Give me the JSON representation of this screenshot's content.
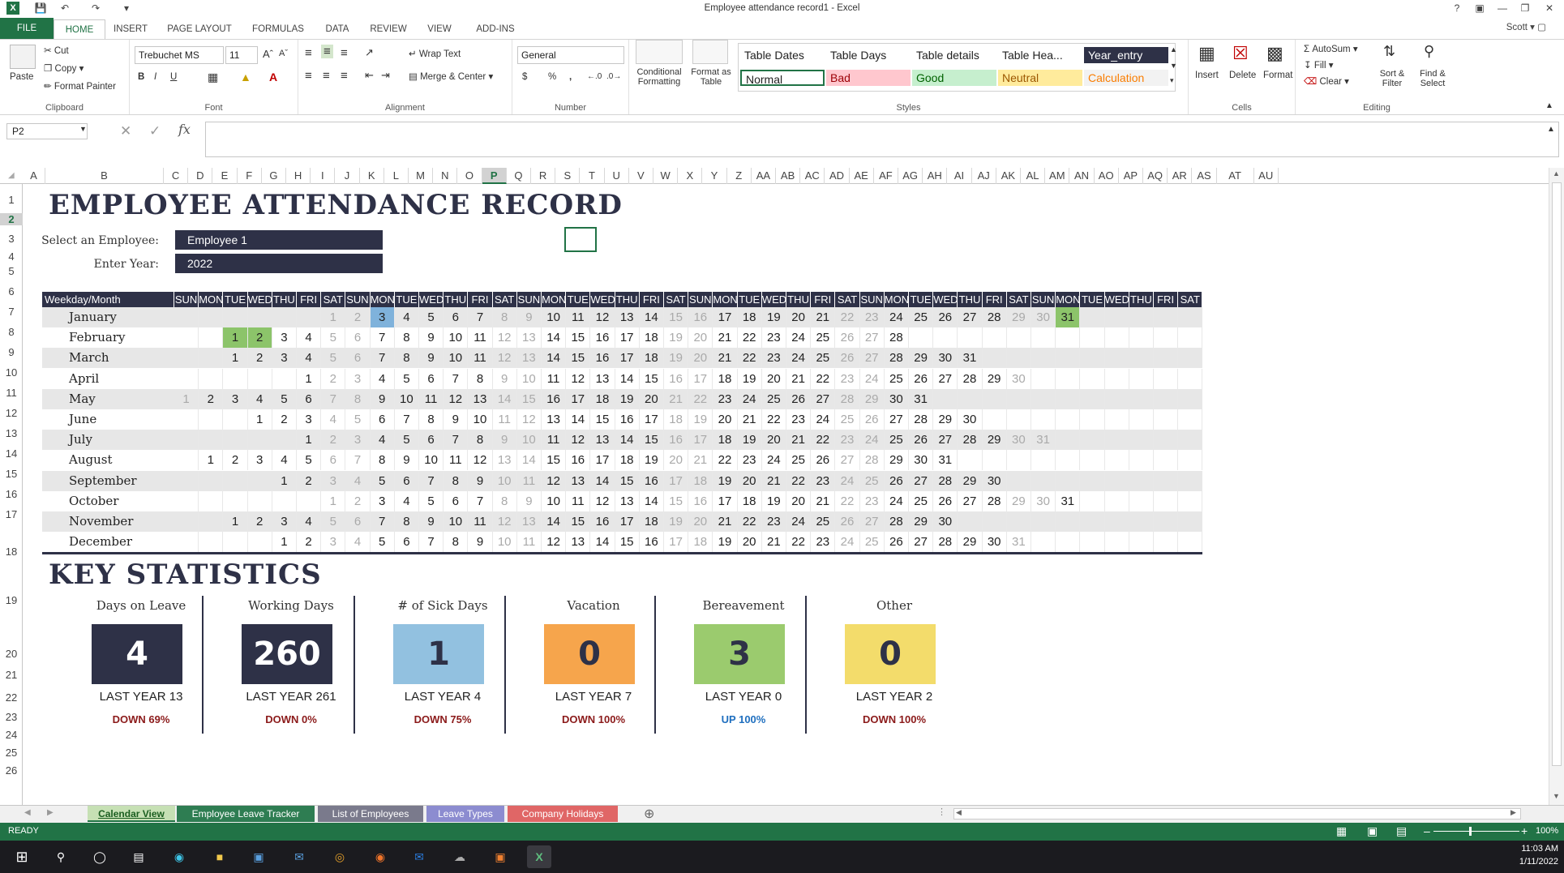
{
  "window": {
    "title": "Employee attendance record1 - Excel",
    "help": "?",
    "user": "Scott"
  },
  "ribbon_tabs": [
    "FILE",
    "HOME",
    "INSERT",
    "PAGE LAYOUT",
    "FORMULAS",
    "DATA",
    "REVIEW",
    "VIEW",
    "ADD-INS"
  ],
  "ribbon": {
    "clipboard": {
      "label": "Clipboard",
      "paste": "Paste",
      "cut": "Cut",
      "copy": "Copy",
      "format_painter": "Format Painter"
    },
    "font": {
      "label": "Font",
      "name": "Trebuchet MS",
      "size": "11",
      "bold": "B",
      "italic": "I",
      "underline": "U"
    },
    "alignment": {
      "label": "Alignment",
      "wrap": "Wrap Text",
      "merge": "Merge & Center"
    },
    "number": {
      "label": "Number",
      "format": "General",
      "currency": "$",
      "percent": "%",
      "comma": ","
    },
    "styles": {
      "label": "Styles",
      "conditional": "Conditional Formatting",
      "format_table": "Format as Table",
      "cells": [
        {
          "text": "Table Dates",
          "bg": "#ffffff",
          "fg": "#222222"
        },
        {
          "text": "Table Days",
          "bg": "#ffffff",
          "fg": "#222222"
        },
        {
          "text": "Table details",
          "bg": "#ffffff",
          "fg": "#222222"
        },
        {
          "text": "Table Hea...",
          "bg": "#ffffff",
          "fg": "#222222"
        },
        {
          "text": "Year_entry",
          "bg": "#2e3147",
          "fg": "#ffffff"
        },
        {
          "text": "Normal",
          "bg": "#ffffff",
          "fg": "#222222"
        },
        {
          "text": "Bad",
          "bg": "#ffc7ce",
          "fg": "#9c0006"
        },
        {
          "text": "Good",
          "bg": "#c6efce",
          "fg": "#006100"
        },
        {
          "text": "Neutral",
          "bg": "#ffeb9c",
          "fg": "#9c5700"
        },
        {
          "text": "Calculation",
          "bg": "#f2f2f2",
          "fg": "#fa7d00"
        }
      ]
    },
    "cells": {
      "label": "Cells",
      "insert": "Insert",
      "delete": "Delete",
      "format": "Format"
    },
    "editing": {
      "label": "Editing",
      "autosum": "AutoSum",
      "fill": "Fill",
      "clear": "Clear",
      "sort": "Sort & Filter",
      "find": "Find & Select"
    }
  },
  "formula_bar": {
    "name_box": "P2",
    "fx": "fx",
    "value": ""
  },
  "columns": [
    "A",
    "B",
    "C",
    "D",
    "E",
    "F",
    "G",
    "H",
    "I",
    "J",
    "K",
    "L",
    "M",
    "N",
    "O",
    "P",
    "Q",
    "R",
    "S",
    "T",
    "U",
    "V",
    "W",
    "X",
    "Y",
    "Z",
    "AA",
    "AB",
    "AC",
    "AD",
    "AE",
    "AF",
    "AG",
    "AH",
    "AI",
    "AJ",
    "AK",
    "AL",
    "AM",
    "AN",
    "AO",
    "AP",
    "AQ",
    "AR",
    "AS",
    "AT",
    "AU"
  ],
  "selected_column": "P",
  "rows": [
    "1",
    "2",
    "3",
    "4",
    "5",
    "6",
    "7",
    "8",
    "9",
    "10",
    "11",
    "12",
    "13",
    "14",
    "15",
    "16",
    "17",
    "18",
    "19",
    "20",
    "21",
    "22",
    "23",
    "24",
    "25",
    "26"
  ],
  "selected_row": "2",
  "sheet": {
    "title": "EMPLOYEE ATTENDANCE RECORD",
    "employee_label": "Select an Employee:",
    "employee_value": "Employee 1",
    "year_label": "Enter Year:",
    "year_value": "2022",
    "corner_label": "Weekday/Month",
    "weekdays": [
      "SUN",
      "MON",
      "TUE",
      "WED",
      "THU",
      "FRI",
      "SAT",
      "SUN",
      "MON",
      "TUE",
      "WED",
      "THU",
      "FRI",
      "SAT",
      "SUN",
      "MON",
      "TUE",
      "WED",
      "THU",
      "FRI",
      "SAT",
      "SUN",
      "MON",
      "TUE",
      "WED",
      "THU",
      "FRI",
      "SAT",
      "SUN",
      "MON",
      "TUE",
      "WED",
      "THU",
      "FRI",
      "SAT",
      "SUN",
      "MON",
      "TUE",
      "WED",
      "THU",
      "FRI",
      "SAT"
    ],
    "months": [
      {
        "name": "January",
        "offset": 6,
        "days": 31
      },
      {
        "name": "February",
        "offset": 2,
        "days": 28
      },
      {
        "name": "March",
        "offset": 2,
        "days": 31
      },
      {
        "name": "April",
        "offset": 5,
        "days": 30
      },
      {
        "name": "May",
        "offset": 0,
        "days": 31
      },
      {
        "name": "June",
        "offset": 3,
        "days": 30
      },
      {
        "name": "July",
        "offset": 5,
        "days": 31
      },
      {
        "name": "August",
        "offset": 1,
        "days": 31
      },
      {
        "name": "September",
        "offset": 4,
        "days": 30
      },
      {
        "name": "October",
        "offset": 6,
        "days": 31
      },
      {
        "name": "November",
        "offset": 2,
        "days": 30
      },
      {
        "name": "December",
        "offset": 4,
        "days": 31
      }
    ],
    "highlights": [
      {
        "month": 0,
        "day": 3,
        "kind": "sel"
      },
      {
        "month": 0,
        "day": 31,
        "kind": "gr"
      },
      {
        "month": 1,
        "day": 1,
        "kind": "gr"
      },
      {
        "month": 1,
        "day": 2,
        "kind": "gr"
      }
    ],
    "stats_title": "KEY STATISTICS",
    "stats": [
      {
        "label": "Days on Leave",
        "value": "4",
        "bg": "#2e3147",
        "fg": "#ffffff",
        "last_year": "LAST YEAR  13",
        "change": "DOWN 69%",
        "up": false
      },
      {
        "label": "Working Days",
        "value": "260",
        "bg": "#2e3147",
        "fg": "#ffffff",
        "last_year": "LAST YEAR  261",
        "change": "DOWN 0%",
        "up": false
      },
      {
        "label": "# of Sick Days",
        "value": "1",
        "bg": "#92c1e0",
        "fg": "#2e3147",
        "last_year": "LAST YEAR  4",
        "change": "DOWN 75%",
        "up": false
      },
      {
        "label": "Vacation",
        "value": "0",
        "bg": "#f6a54c",
        "fg": "#2e3147",
        "last_year": "LAST YEAR  7",
        "change": "DOWN 100%",
        "up": false
      },
      {
        "label": "Bereavement",
        "value": "3",
        "bg": "#9bcb6e",
        "fg": "#2e3147",
        "last_year": "LAST YEAR  0",
        "change": "UP 100%",
        "up": true
      },
      {
        "label": "Other",
        "value": "0",
        "bg": "#f3dc6b",
        "fg": "#2e3147",
        "last_year": "LAST YEAR  2",
        "change": "DOWN 100%",
        "up": false
      }
    ]
  },
  "sheet_tabs": [
    {
      "label": "Calendar View",
      "bg": "#c6e0b4",
      "fg": "#1b5e20",
      "active": true
    },
    {
      "label": "Employee Leave Tracker",
      "bg": "#2e7d52",
      "fg": "#ffffff",
      "active": false
    },
    {
      "label": "List of Employees",
      "bg": "#7a7a8c",
      "fg": "#ffffff",
      "active": false
    },
    {
      "label": "Leave Types",
      "bg": "#8c8cd0",
      "fg": "#ffffff",
      "active": false
    },
    {
      "label": "Company Holidays",
      "bg": "#e06666",
      "fg": "#ffffff",
      "active": false
    }
  ],
  "status": {
    "ready": "READY",
    "zoom": "100%"
  },
  "taskbar": {
    "time": "11:03 AM",
    "date": "1/11/2022"
  }
}
